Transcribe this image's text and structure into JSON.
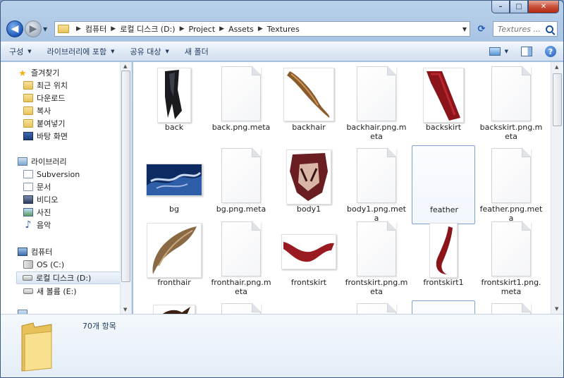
{
  "window": {
    "caption_min": "–",
    "caption_max": "□",
    "caption_close": "✕"
  },
  "address": {
    "breadcrumbs": [
      "컴퓨터",
      "로컬 디스크 (D:)",
      "Project",
      "Assets",
      "Textures"
    ],
    "search_placeholder": "Textures ..."
  },
  "toolbar": {
    "items": [
      "구성",
      "라이브러리에 포함",
      "공유 대상",
      "새 폴더"
    ]
  },
  "navpane": {
    "favorites_header": "즐겨찾기",
    "favorites": [
      "최근 위치",
      "다운로드",
      "복사",
      "붙여넣기",
      "바탕 화면"
    ],
    "libraries_header": "라이브러리",
    "libraries": [
      "Subversion",
      "문서",
      "비디오",
      "사진",
      "음악"
    ],
    "computer_header": "컴퓨터",
    "drives": [
      "OS (C:)",
      "로컬 디스크 (D:)",
      "새 볼륨 (E:)"
    ],
    "selected": "로컬 디스크 (D:)"
  },
  "files": [
    {
      "name": "back",
      "kind": "image",
      "art": "back"
    },
    {
      "name": "back.png.meta",
      "kind": "doc"
    },
    {
      "name": "backhair",
      "kind": "image",
      "art": "backhair"
    },
    {
      "name": "backhair.png.meta",
      "kind": "doc"
    },
    {
      "name": "backskirt",
      "kind": "image",
      "art": "backskirt"
    },
    {
      "name": "backskirt.png.meta",
      "kind": "doc"
    },
    {
      "name": "bg",
      "kind": "image",
      "art": "bg"
    },
    {
      "name": "bg.png.meta",
      "kind": "doc"
    },
    {
      "name": "body1",
      "kind": "image",
      "art": "body1"
    },
    {
      "name": "body1.png.meta",
      "kind": "doc"
    },
    {
      "name": "feather",
      "kind": "image",
      "art": "feather",
      "selected": true
    },
    {
      "name": "feather.png.meta",
      "kind": "doc"
    },
    {
      "name": "fronthair",
      "kind": "image",
      "art": "fronthair"
    },
    {
      "name": "fronthair.png.meta",
      "kind": "doc"
    },
    {
      "name": "frontskirt",
      "kind": "image",
      "art": "frontskirt"
    },
    {
      "name": "frontskirt.png.meta",
      "kind": "doc"
    },
    {
      "name": "frontskirt1",
      "kind": "image",
      "art": "frontskirt1"
    },
    {
      "name": "frontskirt1.png.meta",
      "kind": "doc"
    },
    {
      "name": "",
      "kind": "image",
      "art": "partial"
    },
    {
      "name": "",
      "kind": "doc"
    },
    {
      "name": "",
      "kind": "blank"
    },
    {
      "name": "",
      "kind": "doc"
    },
    {
      "name": "",
      "kind": "image",
      "art": "partial-sel"
    },
    {
      "name": "",
      "kind": "doc"
    }
  ],
  "status": {
    "item_count": "70개 항목"
  },
  "colors": {
    "window_frame": "#a9c4e4",
    "selection": "#7da2ce",
    "back_button": "#1b57b8"
  }
}
